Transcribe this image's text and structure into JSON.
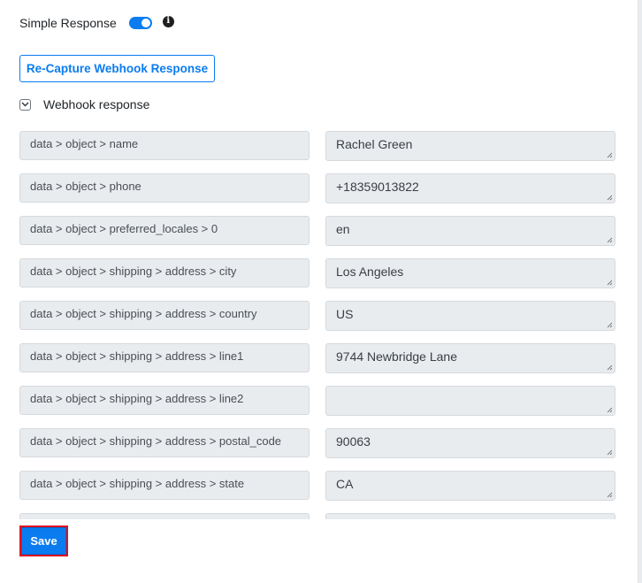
{
  "simple_response": {
    "label": "Simple Response",
    "toggle_on": true,
    "info_icon": "info-circle-icon"
  },
  "recapture_button": {
    "label": "Re-Capture Webhook Response"
  },
  "webhook_section": {
    "label": "Webhook response",
    "expanded": true,
    "toggle_icon": "chevron-down-icon"
  },
  "fields": [
    {
      "key": "data > object > name",
      "value": "Rachel Green"
    },
    {
      "key": "data > object > phone",
      "value": "+18359013822"
    },
    {
      "key": "data > object > preferred_locales > 0",
      "value": "en"
    },
    {
      "key": "data > object > shipping > address > city",
      "value": "Los Angeles"
    },
    {
      "key": "data > object > shipping > address > country",
      "value": "US"
    },
    {
      "key": "data > object > shipping > address > line1",
      "value": "9744 Newbridge Lane"
    },
    {
      "key": "data > object > shipping > address > line2",
      "value": ""
    },
    {
      "key": "data > object > shipping > address > postal_code",
      "value": "90063"
    },
    {
      "key": "data > object > shipping > address > state",
      "value": "CA"
    },
    {
      "key": "",
      "value": ""
    }
  ],
  "save_button": {
    "label": "Save"
  }
}
